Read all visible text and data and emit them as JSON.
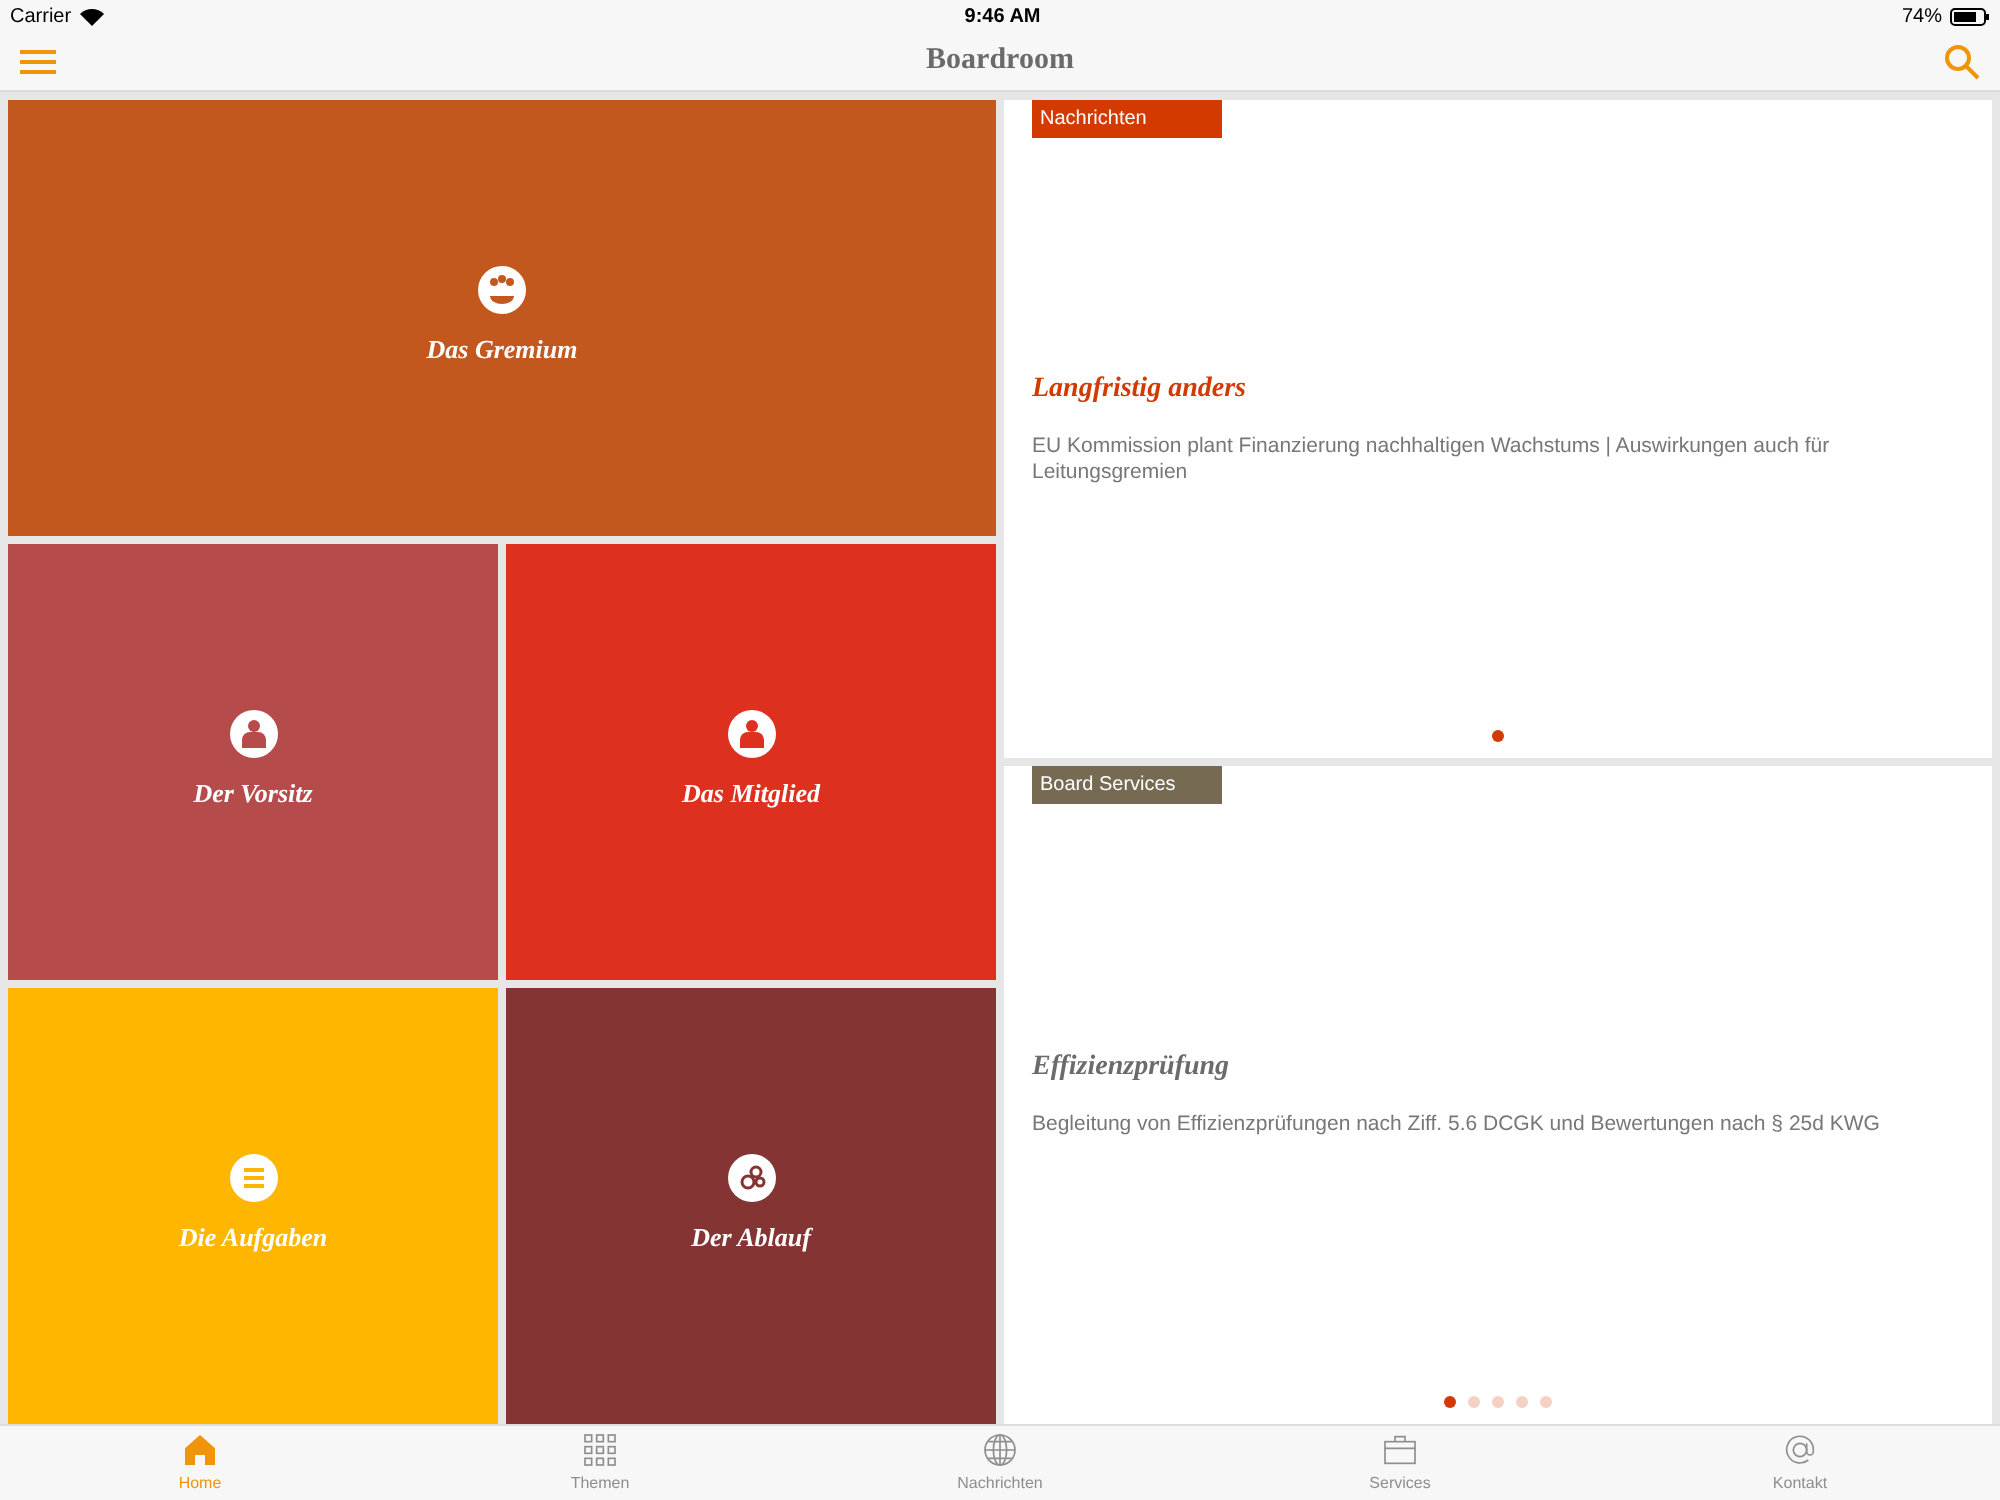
{
  "status_bar": {
    "carrier": "Carrier",
    "time": "9:46 AM",
    "battery": "74%"
  },
  "nav_bar": {
    "title": "Boardroom"
  },
  "tiles": [
    {
      "label": "Das Gremium",
      "kind": "group",
      "color": "#c3581f"
    },
    {
      "label": "Der Vorsitz",
      "kind": "chair",
      "color": "#b54b4b"
    },
    {
      "label": "Das Mitglied",
      "kind": "member",
      "color": "#de301e"
    },
    {
      "label": "Die Aufgaben",
      "kind": "tasks",
      "color": "#ffb600"
    },
    {
      "label": "Der Ablauf",
      "kind": "process",
      "color": "#843433"
    }
  ],
  "cards": [
    {
      "tag": "Nachrichten",
      "kind": "news",
      "title": "Langfristig anders",
      "text": "EU Kommission plant Finanzierung nachhaltigen Wachstums | Auswirkungen auch für Leitungsgremien",
      "dots": [
        {
          "selected": true
        }
      ]
    },
    {
      "tag": "Board Services",
      "kind": "service",
      "title": "Effizienzprüfung",
      "text": "Begleitung von Effizienzprüfungen nach Ziff. 5.6 DCGK und Bewertungen nach § 25d KWG",
      "dots": [
        {
          "selected": true
        },
        {
          "selected": false
        },
        {
          "selected": false
        },
        {
          "selected": false
        },
        {
          "selected": false
        }
      ]
    }
  ],
  "tab_bar": [
    {
      "label": "Home",
      "kind": "home",
      "selected": true
    },
    {
      "label": "Themen",
      "kind": "grid",
      "selected": false
    },
    {
      "label": "Nachrichten",
      "kind": "globe",
      "selected": false
    },
    {
      "label": "Services",
      "kind": "briefcase",
      "selected": false
    },
    {
      "label": "Kontakt",
      "kind": "at",
      "selected": false
    }
  ]
}
